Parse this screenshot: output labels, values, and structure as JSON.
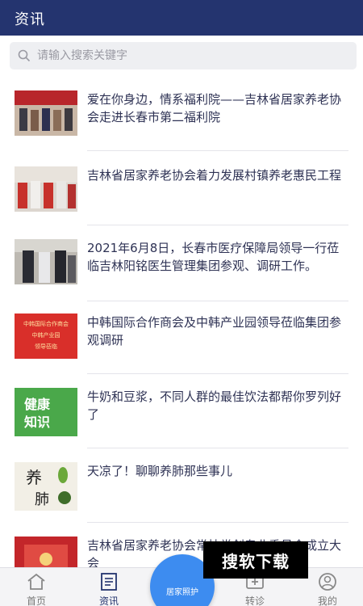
{
  "header": {
    "title": "资讯"
  },
  "search": {
    "placeholder": "请输入搜索关键字"
  },
  "news": [
    {
      "headline": "爱在你身边，情系福利院——吉林省居家养老协会走进长春市第二福利院"
    },
    {
      "headline": "吉林省居家养老协会着力发展村镇养老惠民工程"
    },
    {
      "headline": "2021年6月8日，长春市医疗保障局领导一行莅临吉林阳铭医生管理集团参观、调研工作。"
    },
    {
      "headline": "中韩国际合作商会及中韩产业园领导莅临集团参观调研",
      "thumb_text": [
        "中韩国际合作商会",
        "中韩产业园",
        "领导莅临"
      ]
    },
    {
      "headline": "牛奶和豆浆，不同人群的最佳饮法都帮你罗列好了",
      "thumb_text": [
        "健康",
        "知识"
      ]
    },
    {
      "headline": "天凉了！聊聊养肺那些事儿",
      "thumb_text": [
        "养",
        "肺"
      ]
    },
    {
      "headline": "吉林省居家养老协会常技常创专业委员会成立大会"
    }
  ],
  "tabs": [
    {
      "label": "首页",
      "icon": "home-icon"
    },
    {
      "label": "资讯",
      "icon": "news-icon",
      "active": true
    },
    {
      "label": "转诊",
      "icon": "transfer-icon"
    },
    {
      "label": "我的",
      "icon": "profile-icon"
    }
  ],
  "fab": {
    "label": "居家照护"
  },
  "watermark": {
    "text": "搜软下载"
  },
  "colors": {
    "header": "#24346f",
    "accent": "#3d8cf0",
    "health_green": "#4aa84a"
  }
}
